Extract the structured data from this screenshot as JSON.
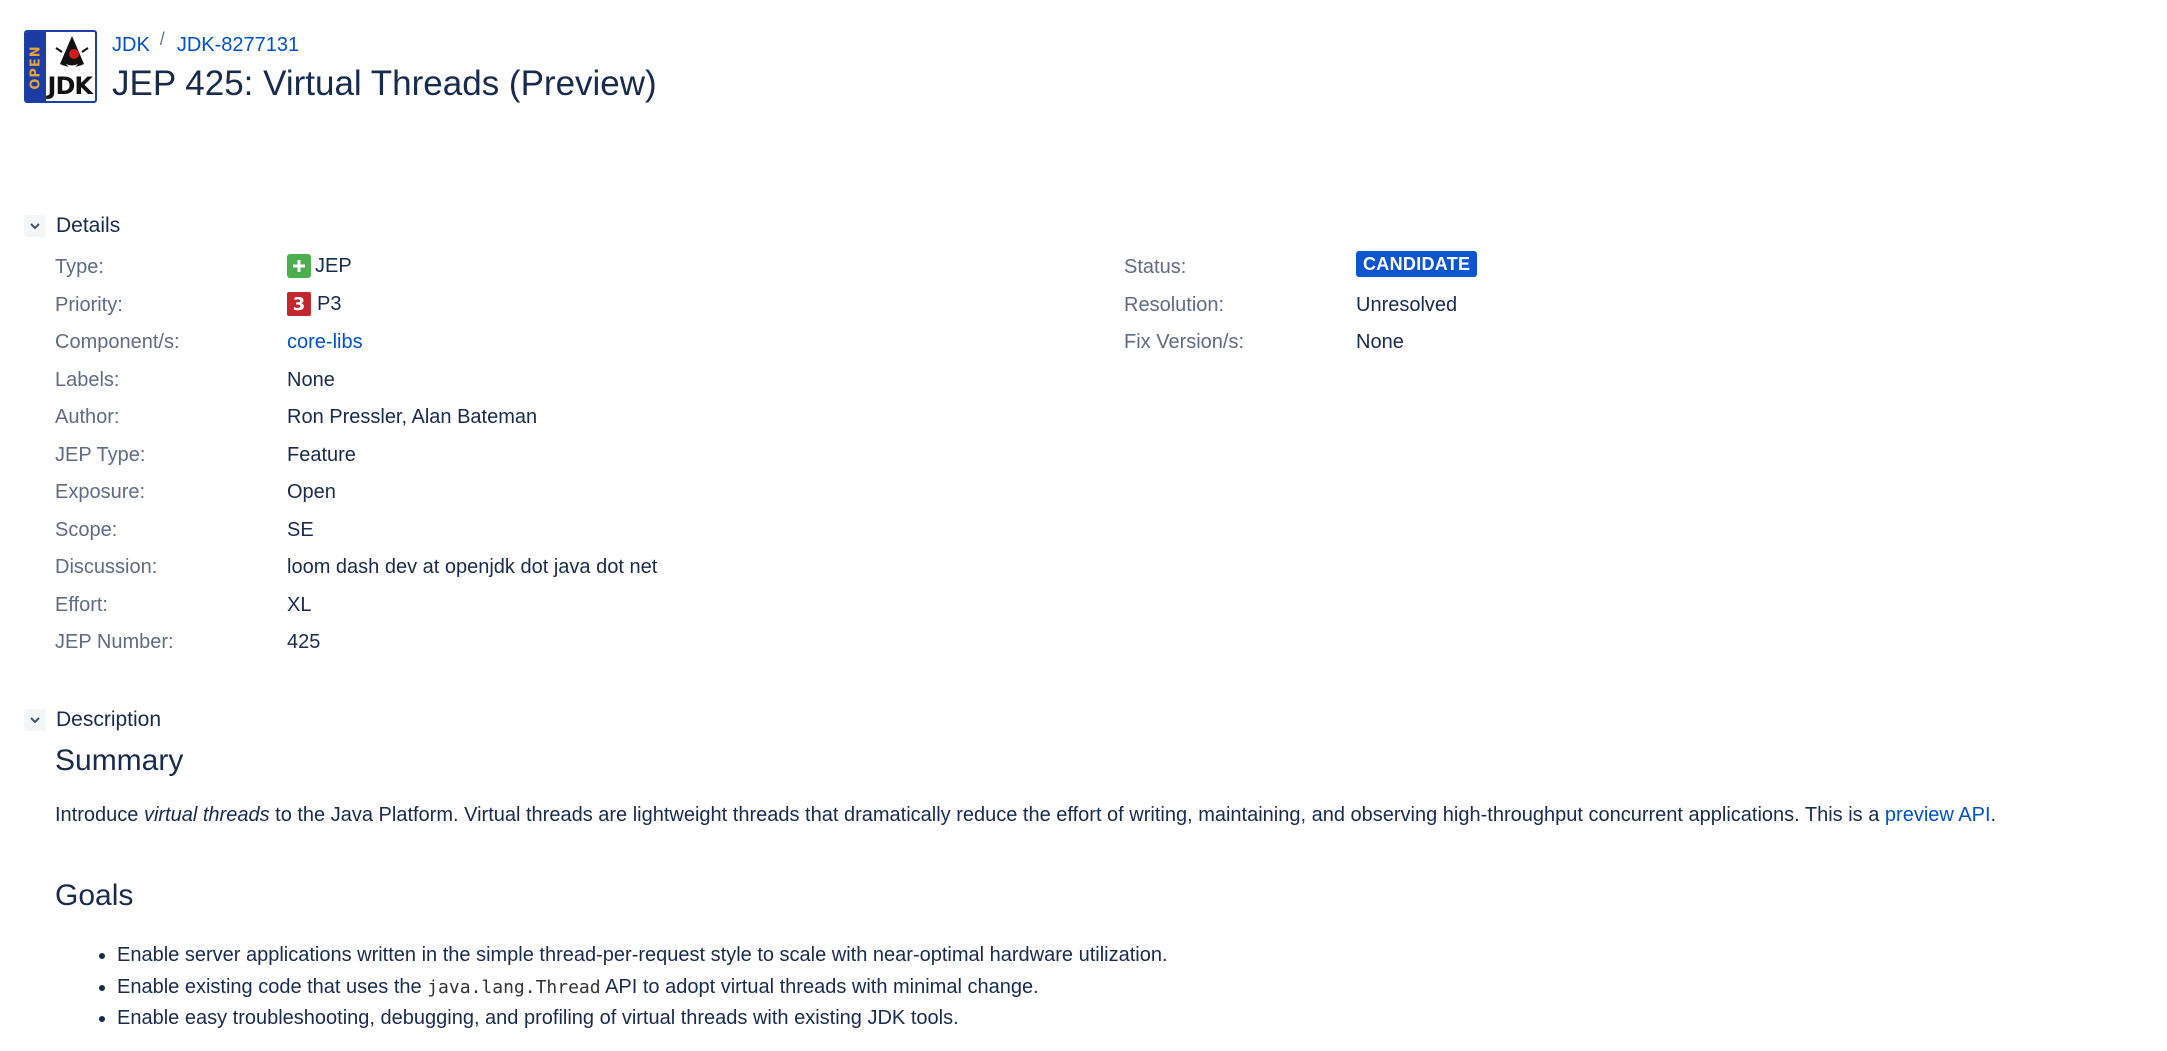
{
  "header": {
    "logo_text": {
      "side": "OPEN",
      "main": "JDK"
    },
    "breadcrumb": [
      "JDK",
      "JDK-8277131"
    ],
    "title": "JEP 425: Virtual Threads (Preview)"
  },
  "details": {
    "heading": "Details",
    "left_fields": [
      {
        "label": "Type:",
        "value": "JEP",
        "icon": "plus-icon"
      },
      {
        "label": "Priority:",
        "value": "P3",
        "icon": "priority-3-icon",
        "icon_text": "3"
      },
      {
        "label": "Component/s:",
        "value": "core-libs"
      },
      {
        "label": "Labels:",
        "value": "None"
      },
      {
        "label": "Author:",
        "value": "Ron Pressler, Alan Bateman"
      },
      {
        "label": "JEP Type:",
        "value": "Feature"
      },
      {
        "label": "Exposure:",
        "value": "Open"
      },
      {
        "label": "Scope:",
        "value": "SE"
      },
      {
        "label": "Discussion:",
        "value": "loom dash dev at openjdk dot java dot net"
      },
      {
        "label": "Effort:",
        "value": "XL"
      },
      {
        "label": "JEP Number:",
        "value": "425"
      }
    ],
    "right_fields": [
      {
        "label": "Status:",
        "value": "CANDIDATE"
      },
      {
        "label": "Resolution:",
        "value": "Unresolved"
      },
      {
        "label": "Fix Version/s:",
        "value": "None"
      }
    ]
  },
  "description": {
    "heading": "Description",
    "summary_heading": "Summary",
    "summary": {
      "intro": "Introduce ",
      "em": "virtual threads",
      "rest": " to the Java Platform. Virtual threads are lightweight threads that dramatically reduce the effort of writing, maintaining, and observing high-throughput concurrent applications. This is a ",
      "link": "preview API",
      "end": "."
    },
    "goals_heading": "Goals",
    "goals": {
      "g1": "Enable server applications written in the simple thread-per-request style to scale with near-optimal hardware utilization.",
      "g2_pre": "Enable existing code that uses the ",
      "g2_code": "java.lang.Thread",
      "g2_post": " API to adopt virtual threads with minimal change.",
      "g3": "Enable easy troubleshooting, debugging, and profiling of virtual threads with existing JDK tools."
    }
  },
  "colors": {
    "link": "#0052cc",
    "label": "#5e6c84",
    "text": "#172b4d",
    "status_badge": "#0c55cf",
    "type_icon": "#4bae4f",
    "priority_icon": "#c1272d"
  }
}
